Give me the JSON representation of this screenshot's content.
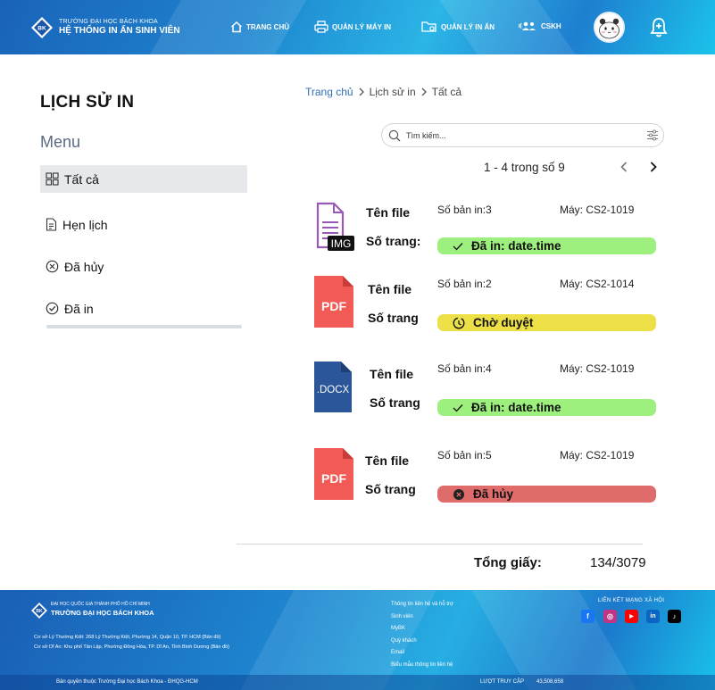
{
  "header": {
    "brand_small": "TRƯỜNG ĐẠI HỌC BÁCH KHOA",
    "brand_big": "HỆ THỐNG IN ẤN SINH VIÊN",
    "logo_text": "BK",
    "nav": [
      {
        "label": "TRANG CHỦ",
        "icon": "home-icon"
      },
      {
        "label": "QUẢN LÝ MÁY IN",
        "icon": "printer-icon"
      },
      {
        "label": "QUẢN LÝ IN ẤN",
        "icon": "folder-settings-icon"
      },
      {
        "label": "CSKH",
        "icon": "support-icon"
      }
    ]
  },
  "sidebar": {
    "page_title": "LỊCH SỬ IN",
    "menu_title": "Menu",
    "items": [
      {
        "label": "Tất cả",
        "icon": "grid-icon",
        "active": true
      },
      {
        "label": "Hẹn lịch",
        "icon": "document-icon"
      },
      {
        "label": "Đã hủy",
        "icon": "x-circle-icon"
      },
      {
        "label": "Đã in",
        "icon": "check-circle-icon"
      }
    ]
  },
  "breadcrumb": [
    "Trang chủ",
    "Lịch sử in",
    "Tất cả"
  ],
  "search": {
    "placeholder": "Tìm kiếm..."
  },
  "pagination": {
    "label": "1 - 4 trong số 9"
  },
  "files": [
    {
      "type": "IMG",
      "name": "Tên file",
      "pages": "Số trang:",
      "copies": "Số bản in:3",
      "machine": "Máy: CS2-1019",
      "status": "Đã in: date.time",
      "status_kind": "done"
    },
    {
      "type": "PDF",
      "name": "Tên file",
      "pages": "Số trang",
      "copies": "Số bản in:2",
      "machine": "Máy: CS2-1014",
      "status": "Chờ duyệt",
      "status_kind": "pending"
    },
    {
      "type": ".DOCX",
      "name": "Tên file",
      "pages": "Số trang",
      "copies": "Số bản in:4",
      "machine": "Máy: CS2-1019",
      "status": "Đã in: date.time",
      "status_kind": "done"
    },
    {
      "type": "PDF",
      "name": "Tên file",
      "pages": "Số trang",
      "copies": "Số bản in:5",
      "machine": "Máy: CS2-1019",
      "status": "Đã hủy",
      "status_kind": "cancelled"
    }
  ],
  "summary": {
    "label": "Tổng giấy:",
    "value": "134/3079"
  },
  "colors": {
    "done": "#9ef07e",
    "pending": "#ece046",
    "cancelled": "#df6b6b",
    "pdf": "#f25a55",
    "docx": "#2b579a",
    "img": "#9b59b6"
  },
  "footer": {
    "small": "ĐẠI HỌC QUỐC GIA THÀNH PHỐ HỒ CHÍ MINH",
    "big": "TRƯỜNG ĐẠI HỌC BÁCH KHOA",
    "address1": "Cơ sở Lý Thường Kiệt: 268 Lý Thường Kiệt, Phường 14, Quận 10, TP. HCM (Bản đồ)",
    "address2": "Cơ sở Dĩ An: Khu phố Tân Lập, Phường Đông Hòa, TP. Dĩ An, Tỉnh Bình Dương (Bản đồ)",
    "links": [
      "Thông tin liên hệ và hỗ trợ",
      "Sinh viên",
      "MyBK",
      "Quý khách",
      "Email",
      "Biểu mẫu thông tin liên hệ"
    ],
    "social_title": "LIÊN KẾT MẠNG XÃ HỘI",
    "social": [
      {
        "name": "facebook-icon",
        "glyph": "f",
        "color": "#1877f2"
      },
      {
        "name": "instagram-icon",
        "glyph": "◎",
        "color": "#c13584"
      },
      {
        "name": "youtube-icon",
        "glyph": "▶",
        "color": "#ff0000"
      },
      {
        "name": "linkedin-icon",
        "glyph": "in",
        "color": "#0a66c2"
      },
      {
        "name": "tiktok-icon",
        "glyph": "♪",
        "color": "#000000"
      }
    ],
    "copyright": "Bản quyền thuộc Trường Đại học Bách Khoa - ĐHQG-HCM",
    "visits_label": "LƯỢT TRUY CẬP",
    "visits_value": "43,508,658"
  }
}
